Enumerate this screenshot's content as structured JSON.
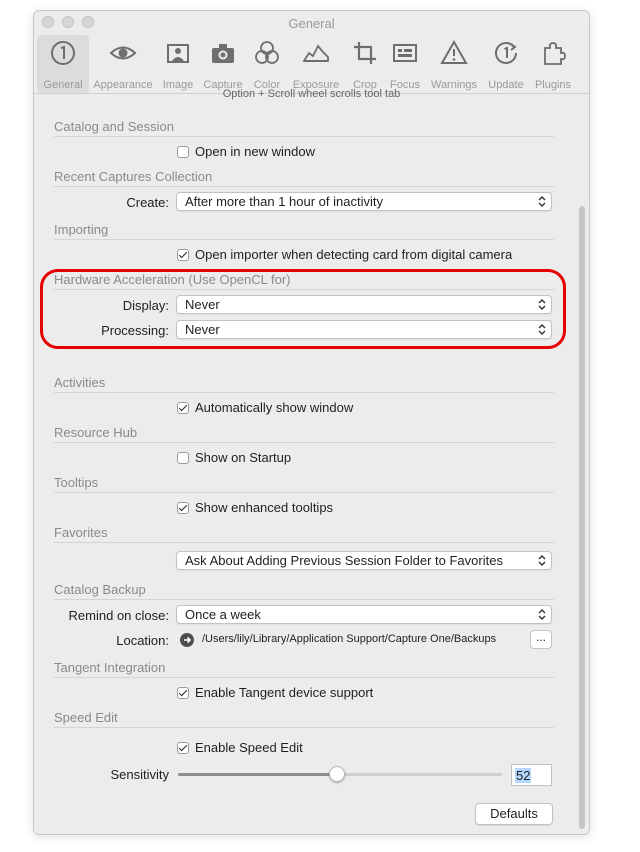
{
  "window": {
    "title": "General"
  },
  "toolbar": {
    "tabs": [
      {
        "label": "General",
        "icon": "number-one-circle-icon",
        "selected": true
      },
      {
        "label": "Appearance",
        "icon": "eye-icon",
        "selected": false
      },
      {
        "label": "Image",
        "icon": "portrait-icon",
        "selected": false
      },
      {
        "label": "Capture",
        "icon": "camera-icon",
        "selected": false
      },
      {
        "label": "Color",
        "icon": "color-circles-icon",
        "selected": false
      },
      {
        "label": "Exposure",
        "icon": "histogram-icon",
        "selected": false
      },
      {
        "label": "Crop",
        "icon": "crop-icon",
        "selected": false
      },
      {
        "label": "Focus",
        "icon": "focus-grid-icon",
        "selected": false
      },
      {
        "label": "Warnings",
        "icon": "warning-triangle-icon",
        "selected": false
      },
      {
        "label": "Update",
        "icon": "update-icon",
        "selected": false
      },
      {
        "label": "Plugins",
        "icon": "puzzle-piece-icon",
        "selected": false
      }
    ]
  },
  "scroll_hint": "Option + Scroll wheel scrolls tool tab",
  "catalog_session": {
    "header": "Catalog and Session",
    "open_new_window": {
      "label": "Open in new window",
      "checked": false
    }
  },
  "recent_captures": {
    "header": "Recent Captures Collection",
    "create_label": "Create:",
    "create_value": "After more than 1 hour of inactivity"
  },
  "importing": {
    "header": "Importing",
    "open_importer": {
      "label": "Open importer when detecting card from digital camera",
      "checked": true
    }
  },
  "hardware_acceleration": {
    "header": "Hardware Acceleration (Use OpenCL for)",
    "display_label": "Display:",
    "display_value": "Never",
    "processing_label": "Processing:",
    "processing_value": "Never",
    "highlight_color": "#e60000"
  },
  "activities": {
    "header": "Activities",
    "auto_show": {
      "label": "Automatically show window",
      "checked": true
    }
  },
  "resource_hub": {
    "header": "Resource Hub",
    "show_startup": {
      "label": "Show on Startup",
      "checked": false
    }
  },
  "tooltips": {
    "header": "Tooltips",
    "enhanced": {
      "label": "Show enhanced tooltips",
      "checked": true
    }
  },
  "favorites": {
    "header": "Favorites",
    "value": "Ask About Adding Previous Session Folder to Favorites"
  },
  "catalog_backup": {
    "header": "Catalog Backup",
    "remind_label": "Remind on close:",
    "remind_value": "Once a week",
    "location_label": "Location:",
    "location_path": "/Users/lily/Library/Application Support/Capture One/Backups",
    "browse_label": "..."
  },
  "tangent": {
    "header": "Tangent Integration",
    "enable": {
      "label": "Enable Tangent device support",
      "checked": true
    }
  },
  "speed_edit": {
    "header": "Speed Edit",
    "enable": {
      "label": "Enable Speed Edit",
      "checked": true
    },
    "sensitivity_label": "Sensitivity",
    "sensitivity_value": "52",
    "sensitivity_fraction": 0.49
  },
  "defaults_label": "Defaults"
}
